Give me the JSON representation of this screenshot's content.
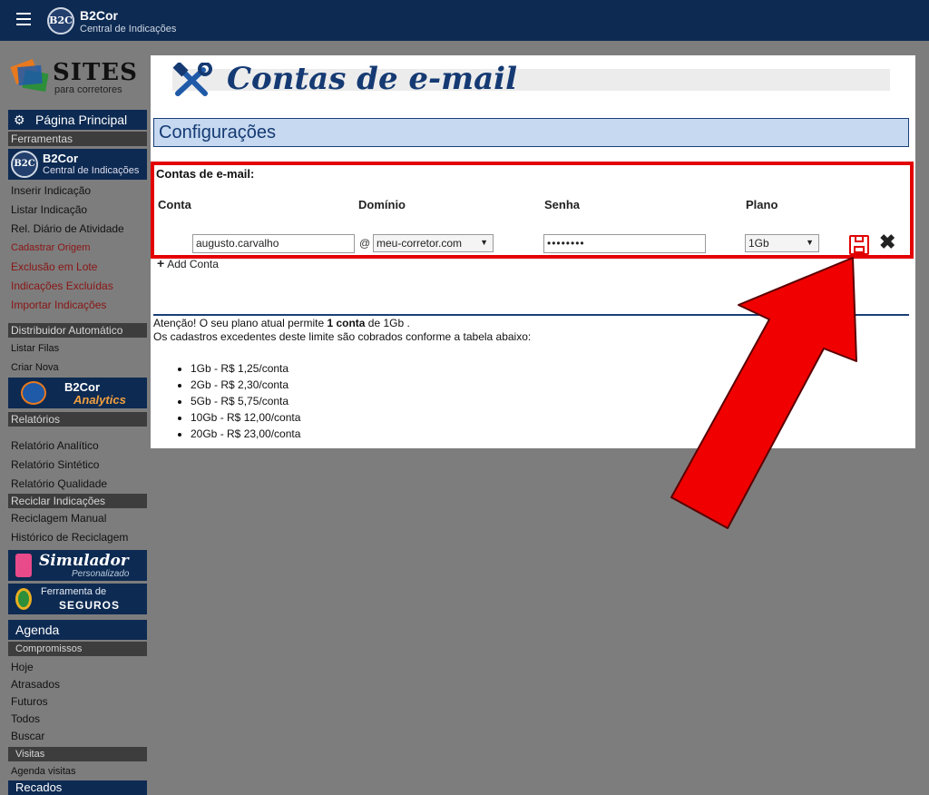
{
  "header": {
    "logo_text": "B2C",
    "brand": "B2Cor",
    "brand_sub": "Central de Indicações"
  },
  "sidebar": {
    "sites_logo": {
      "title": "SITES",
      "subtitle": "para corretores"
    },
    "main_item": "Página Principal",
    "sections": {
      "ferramentas": "Ferramentas",
      "distribuidor": "Distribuidor Automático",
      "relatorios": "Relatórios",
      "reciclar": "Reciclar Indicações"
    },
    "b2cor_banner": {
      "logo": "B2C",
      "title": "B2Cor",
      "subtitle": "Central de Indicações"
    },
    "ferramentas_links": [
      "Inserir Indicação",
      "Listar Indicação",
      "Rel. Diário de Atividade",
      "Cadastrar Origem",
      "Exclusão em Lote",
      "Indicações Excluídas",
      "Importar Indicações"
    ],
    "distribuidor_links": [
      "Listar Filas",
      "Criar Nova"
    ],
    "analytics_banner": {
      "title": "B2Cor",
      "subtitle": "Analytics"
    },
    "relatorios_links": [
      "Relatório Analítico",
      "Relatório Sintético",
      "Relatório Qualidade"
    ],
    "reciclar_links": [
      "Reciclagem Manual",
      "Histórico de Reciclagem"
    ],
    "simulador_banner": {
      "title": "Simulador",
      "subtitle": "Personalizado"
    },
    "seguros_banner": {
      "title": "Ferramenta de",
      "subtitle": "SEGUROS"
    },
    "agenda": "Agenda",
    "compromissos": "Compromissos",
    "agenda_links": [
      "Hoje",
      "Atrasados",
      "Futuros",
      "Todos",
      "Buscar"
    ],
    "visitas": "Visitas",
    "visitas_links": [
      "Agenda visitas"
    ],
    "recados": "Recados"
  },
  "main": {
    "page_title": "Contas de e-mail",
    "config_title": "Configurações",
    "section_label": "Contas de e-mail:",
    "columns": [
      "Conta",
      "Domínio",
      "Senha",
      "Plano"
    ],
    "row": {
      "conta": "augusto.carvalho",
      "at": "@",
      "dominio": "meu-corretor.com",
      "senha": "••••••••",
      "plano": "1Gb"
    },
    "add_account": "Add Conta",
    "notice_prefix": "Atenção! O seu plano atual permite ",
    "notice_bold": "1 conta",
    "notice_suffix": " de 1Gb .",
    "notice_line2": "Os cadastros excedentes deste limite são cobrados conforme a tabela abaixo:",
    "plans": [
      "1Gb - R$ 1,25/conta",
      "2Gb - R$ 2,30/conta",
      "5Gb - R$ 5,75/conta",
      "10Gb - R$ 12,00/conta",
      "20Gb - R$ 23,00/conta"
    ]
  },
  "colors": {
    "navy": "#0d2a52",
    "highlight_red": "#e30000",
    "config_bg": "#c6d9f0"
  }
}
